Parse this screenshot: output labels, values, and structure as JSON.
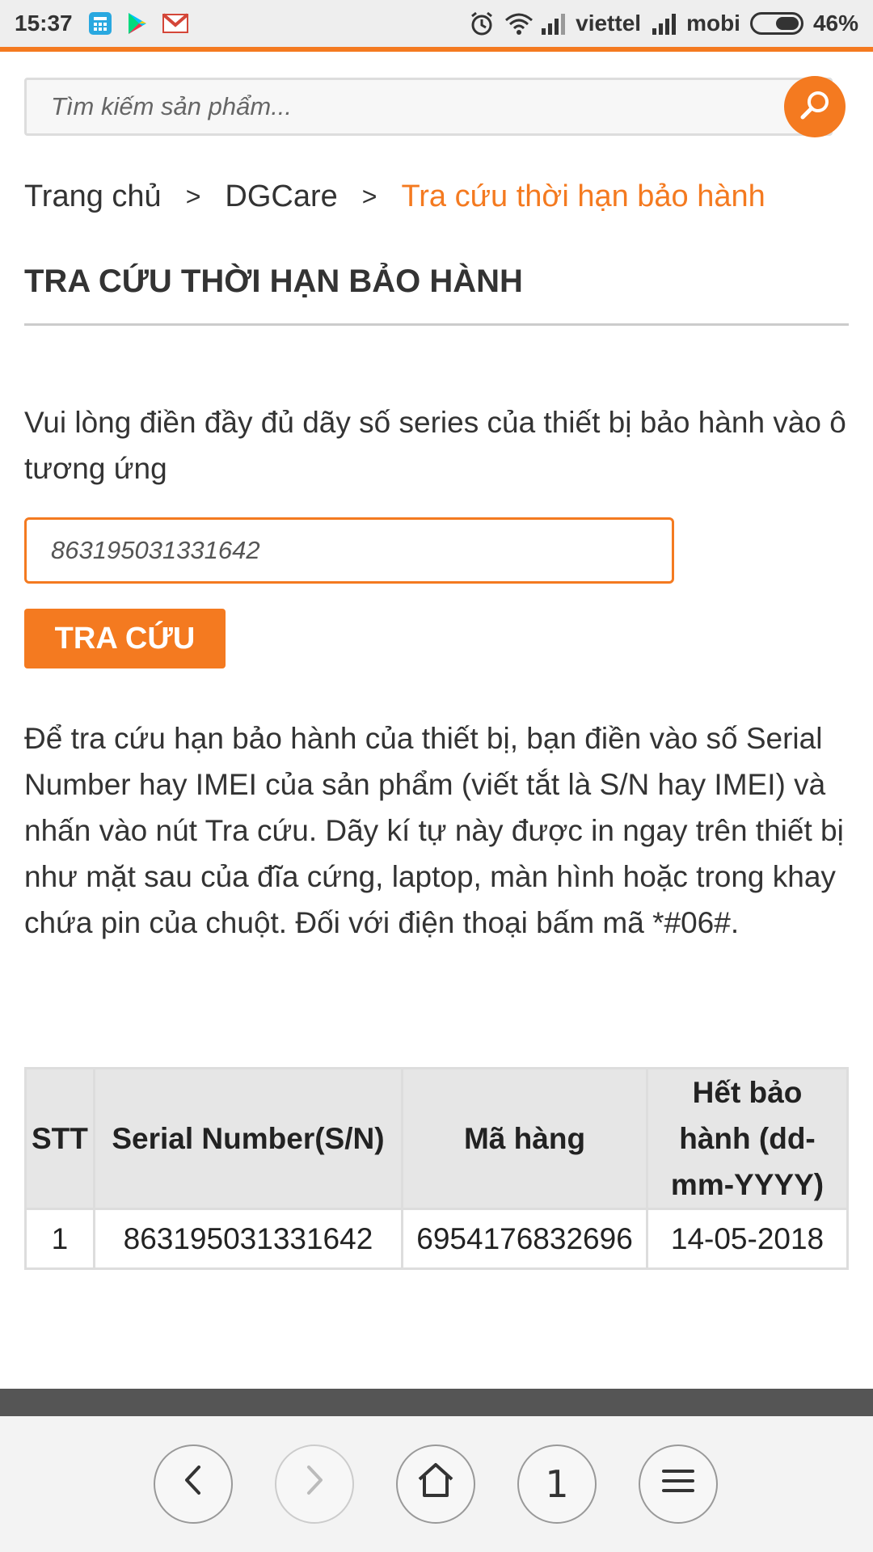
{
  "status_bar": {
    "time": "15:37",
    "carrier1": "viettel",
    "carrier2": "mobi",
    "battery": "46%",
    "icons": [
      "calculator-icon",
      "play-store-icon",
      "gmail-icon",
      "alarm-icon",
      "wifi-icon",
      "signal-icon",
      "signal-icon",
      "battery-icon"
    ]
  },
  "search": {
    "placeholder": "Tìm kiếm sản phẩm...",
    "button_icon": "search-icon"
  },
  "breadcrumb": {
    "items": [
      "Trang chủ",
      "DGCare",
      "Tra cứu thời hạn bảo hành"
    ],
    "separator": ">"
  },
  "page": {
    "title": "TRA CỨU THỜI HẠN BẢO HÀNH",
    "instruction": "Vui lòng điền đầy đủ dãy số series của thiết bị bảo hành vào ô tương ứng",
    "serial_value": "863195031331642",
    "lookup_label": "TRA CỨU",
    "help_text": "Để tra cứu hạn bảo hành của thiết bị, bạn điền vào số Serial Number hay IMEI của sản phẩm (viết tắt là S/N hay IMEI) và nhấn vào nút Tra cứu. Dãy kí tự này được in ngay trên thiết bị như mặt sau của đĩa cứng, laptop, màn hình hoặc trong khay chứa pin của chuột. Đối với điện thoại bấm mã *#06#."
  },
  "table": {
    "headers": [
      "STT",
      "Serial Number(S/N)",
      "Mã hàng",
      "Hết bảo hành (dd-mm-YYYY)"
    ],
    "rows": [
      [
        "1",
        "863195031331642",
        "6954176832696",
        "14-05-2018"
      ]
    ]
  },
  "bottom_nav": {
    "tab_count": "1",
    "buttons": [
      "back-icon",
      "forward-icon",
      "home-icon",
      "tabs-button",
      "menu-icon"
    ]
  },
  "colors": {
    "accent": "#f47a20",
    "dark_bar": "#555555"
  }
}
